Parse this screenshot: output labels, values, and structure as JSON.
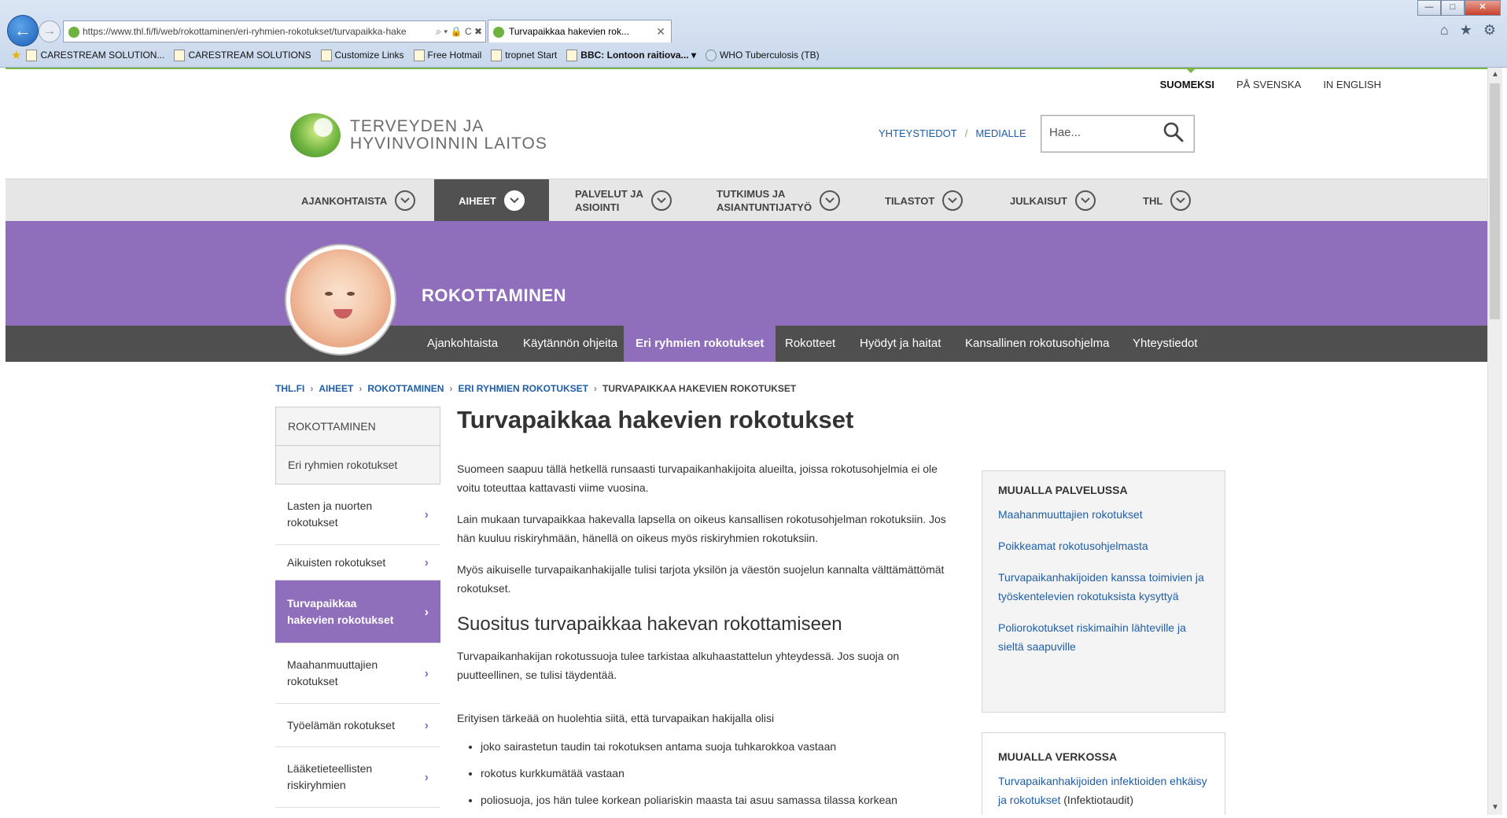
{
  "browser": {
    "address": "https://www.thl.fi/fi/web/rokottaminen/eri-ryhmien-rokotukset/turvapaikka-hake",
    "tab_title": "Turvapaikkaa hakevien rok...",
    "favorites": [
      {
        "label": "CARESTREAM SOLUTION...",
        "bold": false
      },
      {
        "label": "CARESTREAM SOLUTIONS",
        "bold": false
      },
      {
        "label": "Customize Links",
        "bold": false
      },
      {
        "label": "Free Hotmail",
        "bold": false
      },
      {
        "label": "tropnet Start",
        "bold": false
      },
      {
        "label": "BBC: Lontoon raitiova...",
        "bold": true
      },
      {
        "label": "WHO  Tuberculosis (TB)",
        "bold": false
      }
    ]
  },
  "header": {
    "languages": [
      "SUOMEKSI",
      "PÅ SVENSKA",
      "IN ENGLISH"
    ],
    "logo_line1": "TERVEYDEN JA",
    "logo_line2": "HYVINVOINNIN LAITOS",
    "links": [
      "YHTEYSTIEDOT",
      "/",
      "MEDIALLE"
    ],
    "search_placeholder": "Hae..."
  },
  "mainnav": [
    {
      "label": "AJANKOHTAISTA"
    },
    {
      "label": "AIHEET"
    },
    {
      "label": "PALVELUT JA\nASIOINTI"
    },
    {
      "label": "TUTKIMUS JA\nASIANTUNTIJATYÖ"
    },
    {
      "label": "TILASTOT"
    },
    {
      "label": "JULKAISUT"
    },
    {
      "label": "THL"
    }
  ],
  "banner": {
    "title": "ROKOTTAMINEN",
    "subnav": [
      "Ajankohtaista",
      "Käytännön ohjeita",
      "Eri ryhmien rokotukset",
      "Rokotteet",
      "Hyödyt ja haitat",
      "Kansallinen rokotusohjelma",
      "Yhteystiedot"
    ]
  },
  "breadcrumb": [
    "THL.FI",
    "AIHEET",
    "ROKOTTAMINEN",
    "ERI RYHMIEN ROKOTUKSET",
    "TURVAPAIKKAA HAKEVIEN ROKOTUKSET"
  ],
  "leftnav": {
    "top": "ROKOTTAMINEN",
    "sub": "Eri ryhmien rokotukset",
    "items": [
      "Lasten ja nuorten\nrokotukset",
      "Aikuisten rokotukset",
      "Turvapaikkaa\nhakevien rokotukset",
      "Maahanmuuttajien\nrokotukset",
      "Työelämän rokotukset",
      "Lääketieteellisten\nriskiryhmien"
    ]
  },
  "main": {
    "title": "Turvapaikkaa hakevien rokotukset",
    "p1": "Suomeen saapuu tällä hetkellä runsaasti turvapaikanhakijoita alueilta, joissa rokotusohjelmia ei ole voitu toteuttaa kattavasti viime vuosina.",
    "p2": "Lain mukaan turvapaikkaa hakevalla lapsella on oikeus kansallisen rokotusohjelman rokotuksiin. Jos hän kuuluu riskiryhmään, hänellä on oikeus myös riskiryhmien rokotuksiin.",
    "p3": "Myös aikuiselle turvapaikanhakijalle tulisi tarjota yksilön ja väestön suojelun kannalta välttämättömät rokotukset.",
    "h2": "Suositus turvapaikkaa hakevan rokottamiseen",
    "p4": "Turvapaikanhakijan rokotussuoja tulee tarkistaa alkuhaastattelun yhteydessä. Jos suoja on puutteellinen, se tulisi täydentää.",
    "p5": "Erityisen tärkeää on huolehtia siitä, että turvapaikan hakijalla olisi",
    "bullets": [
      "joko sairastetun taudin tai rokotuksen antama suoja tuhkarokkoa vastaan",
      "rokotus kurkkumätää vastaan",
      "poliosuoja, jos hän tulee korkean poliariskin maasta tai asuu samassa tilassa korkean"
    ]
  },
  "right": {
    "box1_title": "MUUALLA PALVELUSSA",
    "box1_links": [
      "Maahanmuuttajien rokotukset",
      "Poikkeamat rokotusohjelmasta",
      "Turvapaikanhakijoiden kanssa toimivien ja työskentelevien rokotuksista kysyttyä",
      "Poliorokotukset riskimaihin lähteville ja sieltä saapuville"
    ],
    "box2_title": "MUUALLA VERKOSSA",
    "box2_link": "Turvapaikanhakijoiden infektioiden ehkäisy ja rokotukset",
    "box2_tail": " (Infektiotaudit)"
  },
  "colors": {
    "purple": "#8f6fbc",
    "green": "#7ab648",
    "link": "#1e5ea8",
    "darknav": "#4f4f4f"
  }
}
